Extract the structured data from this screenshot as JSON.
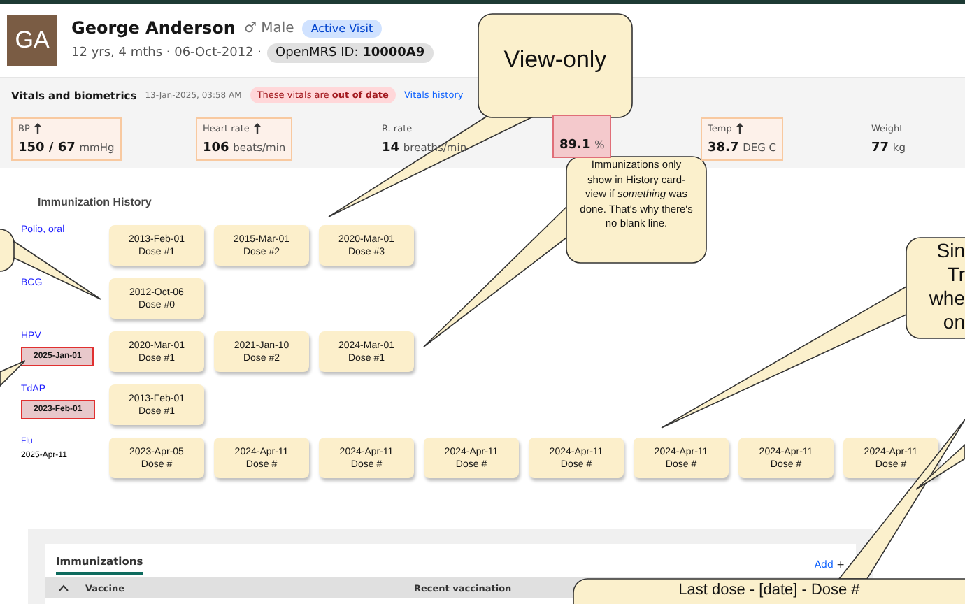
{
  "patient": {
    "initials": "GA",
    "name": "George Anderson",
    "sex": "♂ Male",
    "visit_badge": "Active Visit",
    "summary": "12 yrs, 4 mths · 06-Oct-2012 ·",
    "id_badge": "OpenMRS ID: **10000A9**"
  },
  "vitals_header": {
    "title": "Vitals and biometrics",
    "timestamp": "13-Jan-2025, 03:58 AM",
    "warning": "These vitals are **out of date**",
    "history_link": "Vitals history"
  },
  "vitals": [
    {
      "label": "BP",
      "value": "150 / 67",
      "unit": "mmHg",
      "high": true,
      "critical": false
    },
    {
      "label": "Heart rate",
      "value": "106",
      "unit": "beats/min",
      "high": true,
      "critical": false
    },
    {
      "label": "R. rate",
      "value": "14",
      "unit": "breaths/min",
      "high": false,
      "critical": false
    },
    {
      "value": "89.1",
      "unit": "%",
      "high": false,
      "critical": true
    },
    {
      "label": "Temp",
      "value": "38.7",
      "unit": "DEG C",
      "high": true,
      "critical": false
    },
    {
      "label": "Weight",
      "value": "77",
      "unit": "kg",
      "high": false,
      "critical": false
    }
  ],
  "history": {
    "title": "Immunization History",
    "vaccines": [
      {
        "name": "Polio, oral",
        "doses": [
          {
            "date": "2013-Feb-01",
            "dose": "Dose #1"
          },
          {
            "date": "2015-Mar-01",
            "dose": "Dose #2"
          },
          {
            "date": "2020-Mar-01",
            "dose": "Dose #3"
          }
        ]
      },
      {
        "name": "BCG",
        "doses": [
          {
            "date": "2012-Oct-06",
            "dose": "Dose #0"
          }
        ]
      },
      {
        "name": "HPV",
        "note": {
          "text": "2025-Jan-01",
          "kind": "overdue"
        },
        "doses": [
          {
            "date": "2020-Mar-01",
            "dose": "Dose #1"
          },
          {
            "date": "2021-Jan-10",
            "dose": "Dose #2"
          },
          {
            "date": "2024-Mar-01",
            "dose": "Dose #1"
          }
        ]
      },
      {
        "name": "TdAP",
        "note": {
          "text": "2023-Feb-01",
          "kind": "overdue"
        },
        "doses": [
          {
            "date": "2013-Feb-01",
            "dose": "Dose #1"
          }
        ]
      },
      {
        "name": "Flu",
        "note": {
          "text": "2025-Apr-11",
          "kind": "plain"
        },
        "doses": [
          {
            "date": "2023-Apr-05",
            "dose": "Dose #"
          },
          {
            "date": "2024-Apr-11",
            "dose": "Dose #"
          },
          {
            "date": "2024-Apr-11",
            "dose": "Dose #"
          },
          {
            "date": "2024-Apr-11",
            "dose": "Dose #"
          },
          {
            "date": "2024-Apr-11",
            "dose": "Dose #"
          },
          {
            "date": "2024-Apr-11",
            "dose": "Dose #"
          },
          {
            "date": "2024-Apr-11",
            "dose": "Dose #"
          },
          {
            "date": "2024-Apr-11",
            "dose": "Dose #"
          }
        ]
      }
    ]
  },
  "immunizations_panel": {
    "tab": "Immunizations",
    "add": "Add",
    "add_icon": "+",
    "columns": [
      "Vaccine",
      "Recent vaccination"
    ]
  },
  "callouts": [
    {
      "lines": [
        "View-only"
      ]
    },
    {
      "lines": [
        "Immunizations only show in History card-view if *something* was done. That's why there's no blank line."
      ]
    },
    {
      "lines": [
        "Sin",
        "Tr",
        "whe",
        "on"
      ]
    },
    {
      "lines": [
        "Last dose - [date] - Dose #"
      ]
    }
  ]
}
